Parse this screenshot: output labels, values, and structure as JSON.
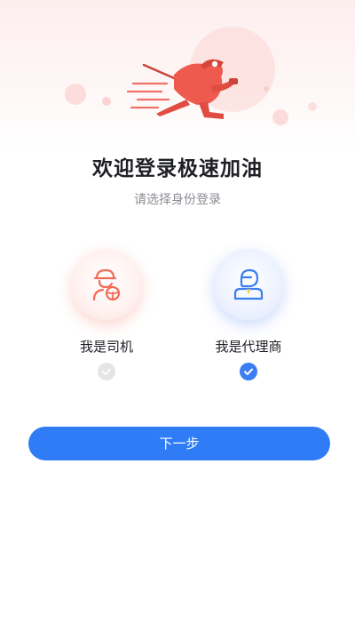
{
  "header": {
    "title": "欢迎登录极速加油",
    "subtitle": "请选择身份登录",
    "illustration_icon": "running-fuel-attendant-illustration"
  },
  "roles": [
    {
      "label": "我是司机",
      "icon": "driver-steering-wheel-icon",
      "selected": false,
      "accent": "#f26a56"
    },
    {
      "label": "我是代理商",
      "icon": "agent-person-icon",
      "selected": true,
      "accent": "#3b7df3"
    }
  ],
  "actions": {
    "next_label": "下一步"
  },
  "colors": {
    "primary": "#2f7cf6",
    "hero_red": "#ee5a4e",
    "check_unselected": "#e5e5e8",
    "title_text": "#1e2026",
    "subtitle_text": "#8a8d94"
  }
}
